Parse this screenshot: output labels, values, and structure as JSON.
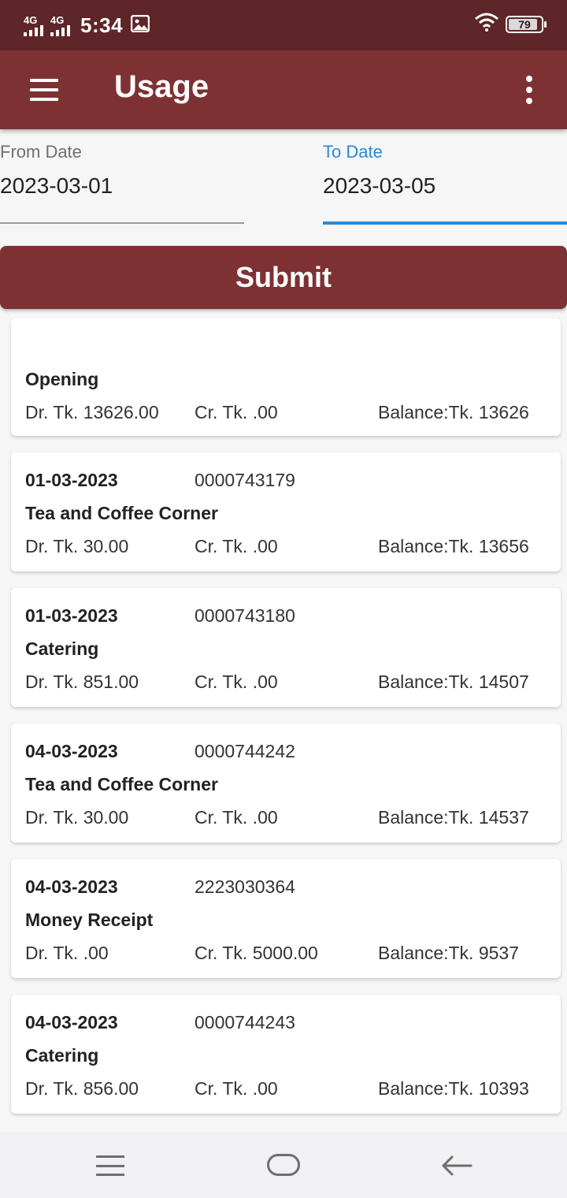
{
  "status_bar": {
    "signal1": "4G",
    "signal2": "4G",
    "time": "5:34",
    "battery": "79"
  },
  "app_bar": {
    "title": "Usage"
  },
  "filters": {
    "from_label": "From Date",
    "from_value": "2023-03-01",
    "to_label": "To Date",
    "to_value": "2023-03-05",
    "submit_label": "Submit"
  },
  "entries": [
    {
      "date": "",
      "ref": "",
      "desc": "Opening",
      "dr": "Dr. Tk. 13626.00",
      "cr": "Cr. Tk. .00",
      "balance": "Balance:Tk. 13626"
    },
    {
      "date": "01-03-2023",
      "ref": "0000743179",
      "desc": "Tea and Coffee Corner",
      "dr": "Dr. Tk. 30.00",
      "cr": "Cr. Tk. .00",
      "balance": "Balance:Tk. 13656"
    },
    {
      "date": "01-03-2023",
      "ref": "0000743180",
      "desc": "Catering",
      "dr": "Dr. Tk. 851.00",
      "cr": "Cr. Tk. .00",
      "balance": "Balance:Tk. 14507"
    },
    {
      "date": "04-03-2023",
      "ref": "0000744242",
      "desc": "Tea and Coffee Corner",
      "dr": "Dr. Tk. 30.00",
      "cr": "Cr. Tk. .00",
      "balance": "Balance:Tk. 14537"
    },
    {
      "date": "04-03-2023",
      "ref": "2223030364",
      "desc": "Money Receipt",
      "dr": "Dr. Tk. .00",
      "cr": "Cr. Tk. 5000.00",
      "balance": "Balance:Tk. 9537"
    },
    {
      "date": "04-03-2023",
      "ref": "0000744243",
      "desc": "Catering",
      "dr": "Dr. Tk. 856.00",
      "cr": "Cr. Tk. .00",
      "balance": "Balance:Tk. 10393"
    }
  ],
  "colors": {
    "app_bar": "#7e3133",
    "status_bar": "#5e2628",
    "accent": "#2a8ad6"
  }
}
